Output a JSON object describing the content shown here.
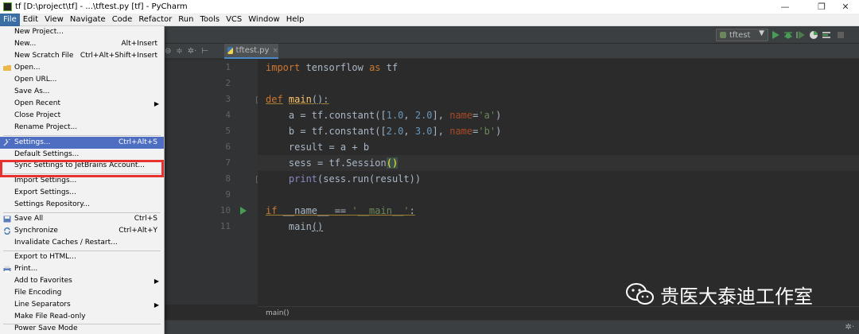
{
  "window": {
    "title": "tf [D:\\project\\tf] - ...\\tftest.py [tf] - PyCharm",
    "controls": {
      "minimize": "—",
      "maximize": "❐",
      "close": "✕"
    }
  },
  "menubar": {
    "items": [
      "File",
      "Edit",
      "View",
      "Navigate",
      "Code",
      "Refactor",
      "Run",
      "Tools",
      "VCS",
      "Window",
      "Help"
    ],
    "active": "File"
  },
  "file_menu": {
    "items": [
      {
        "label": "New Project...",
        "shortcut": ""
      },
      {
        "label": "New...",
        "shortcut": "Alt+Insert"
      },
      {
        "label": "New Scratch File",
        "shortcut": "Ctrl+Alt+Shift+Insert"
      },
      {
        "label": "Open...",
        "shortcut": "",
        "icon": "folder-icon"
      },
      {
        "label": "Open URL...",
        "shortcut": ""
      },
      {
        "label": "Save As...",
        "shortcut": ""
      },
      {
        "label": "Open Recent",
        "shortcut": "",
        "submenu": true
      },
      {
        "label": "Close Project",
        "shortcut": ""
      },
      {
        "label": "Rename Project...",
        "shortcut": ""
      },
      {
        "label": "Settings...",
        "shortcut": "Ctrl+Alt+S",
        "icon": "wrench-icon",
        "selected": true
      },
      {
        "label": "Default Settings...",
        "shortcut": ""
      },
      {
        "label": "Sync Settings to JetBrains Account...",
        "shortcut": ""
      },
      {
        "label": "Import Settings...",
        "shortcut": ""
      },
      {
        "label": "Export Settings...",
        "shortcut": ""
      },
      {
        "label": "Settings Repository...",
        "shortcut": ""
      },
      {
        "label": "Save All",
        "shortcut": "Ctrl+S",
        "icon": "save-icon"
      },
      {
        "label": "Synchronize",
        "shortcut": "Ctrl+Alt+Y",
        "icon": "sync-icon"
      },
      {
        "label": "Invalidate Caches / Restart...",
        "shortcut": ""
      },
      {
        "label": "Export to HTML...",
        "shortcut": ""
      },
      {
        "label": "Print...",
        "shortcut": "",
        "icon": "print-icon"
      },
      {
        "label": "Add to Favorites",
        "shortcut": "",
        "submenu": true
      },
      {
        "label": "File Encoding",
        "shortcut": ""
      },
      {
        "label": "Line Separators",
        "shortcut": "",
        "submenu": true
      },
      {
        "label": "Make File Read-only",
        "shortcut": ""
      },
      {
        "label": "Power Save Mode",
        "shortcut": ""
      }
    ]
  },
  "toolbar": {
    "run_config": "tftest"
  },
  "editor_tab": {
    "filename": "tftest.py",
    "close": "×"
  },
  "editor": {
    "line_numbers": [
      "1",
      "2",
      "3",
      "4",
      "5",
      "6",
      "7",
      "8",
      "9",
      "10",
      "11"
    ]
  },
  "breadcrumb": "main()",
  "watermark": {
    "text": "贵医大泰迪工作室"
  },
  "colors": {
    "highlight_box": "#e8322f",
    "selected_item": "#4e6ec2",
    "editor_bg": "#2b2b2b",
    "keyword": "#cc7832",
    "string": "#6a8759",
    "number": "#6897bb"
  }
}
